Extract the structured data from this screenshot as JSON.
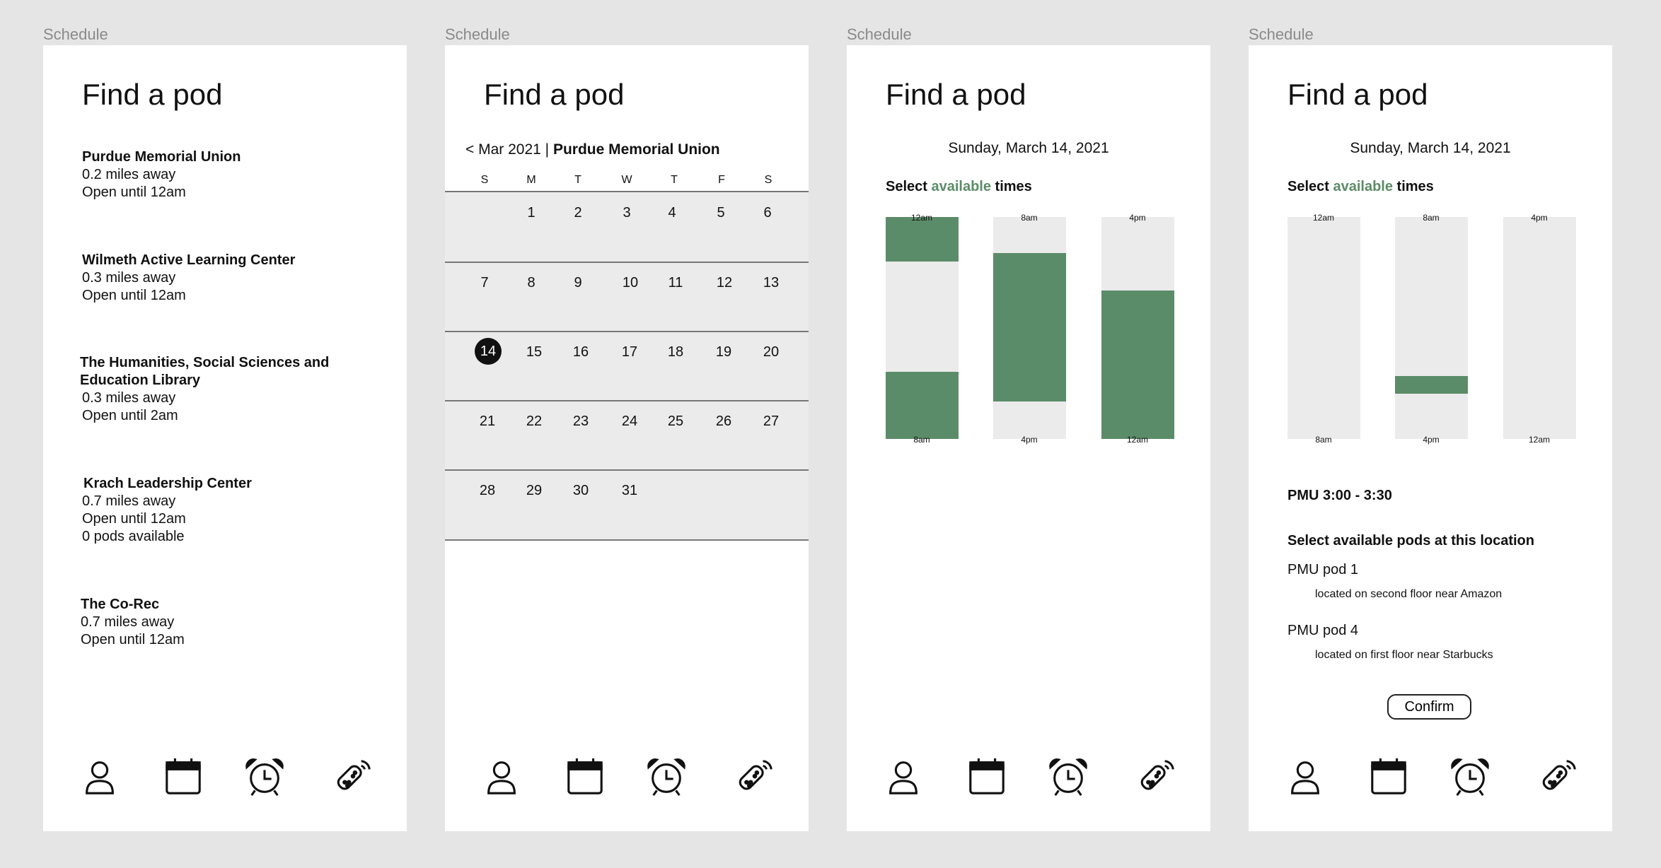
{
  "frame_label": "Schedule",
  "page_title": "Find a pod",
  "locations": [
    {
      "name": "Purdue Memorial Union",
      "distance": "0.2 miles away",
      "hours": "Open until 12am"
    },
    {
      "name": "Wilmeth Active Learning Center",
      "distance": "0.3 miles away",
      "hours": "Open until 12am"
    },
    {
      "name_line1": "The Humanities, Social Sciences and",
      "name_line2": "Education Library",
      "distance": "0.3 miles away",
      "hours": "Open until 2am"
    },
    {
      "name": "Krach Leadership Center",
      "distance": "0.7 miles away",
      "hours": "Open until 12am",
      "pods": "0 pods available"
    },
    {
      "name": "The Co-Rec",
      "distance": "0.7 miles away",
      "hours": "Open until 12am"
    }
  ],
  "calendar": {
    "prev": "< Mar 2021 | ",
    "location": "Purdue Memorial Union",
    "weekdays": [
      "S",
      "M",
      "T",
      "W",
      "T",
      "F",
      "S"
    ],
    "selected_day": "14",
    "weeks": [
      [
        "",
        "1",
        "2",
        "3",
        "4",
        "5",
        "6"
      ],
      [
        "7",
        "8",
        "9",
        "10",
        "11",
        "12",
        "13"
      ],
      [
        "14",
        "15",
        "16",
        "17",
        "18",
        "19",
        "20"
      ],
      [
        "21",
        "22",
        "23",
        "24",
        "25",
        "26",
        "27"
      ],
      [
        "28",
        "29",
        "30",
        "31",
        "",
        "",
        ""
      ]
    ]
  },
  "date_title": "Sunday, March 14, 2021",
  "select_times": {
    "prefix": "Select ",
    "accent": "available",
    "suffix": " times"
  },
  "time_columns": {
    "top_labels": [
      "12am",
      "8am",
      "4pm"
    ],
    "bottom_labels": [
      "8am",
      "4pm",
      "12am"
    ]
  },
  "slot_summary": "PMU 3:00 - 3:30",
  "pods_title": "Select available pods at this location",
  "pods": [
    {
      "name": "PMU pod 1",
      "desc": "located on second floor near Amazon"
    },
    {
      "name": "PMU pod 4",
      "desc": "located on first floor near Starbucks"
    }
  ],
  "confirm_label": "Confirm",
  "nav_icons": [
    "profile-icon",
    "calendar-icon",
    "alarm-clock-icon",
    "remote-icon"
  ],
  "colors": {
    "accent": "#5b8c69",
    "background": "#e5e5e5",
    "panel": "#ebebeb"
  }
}
